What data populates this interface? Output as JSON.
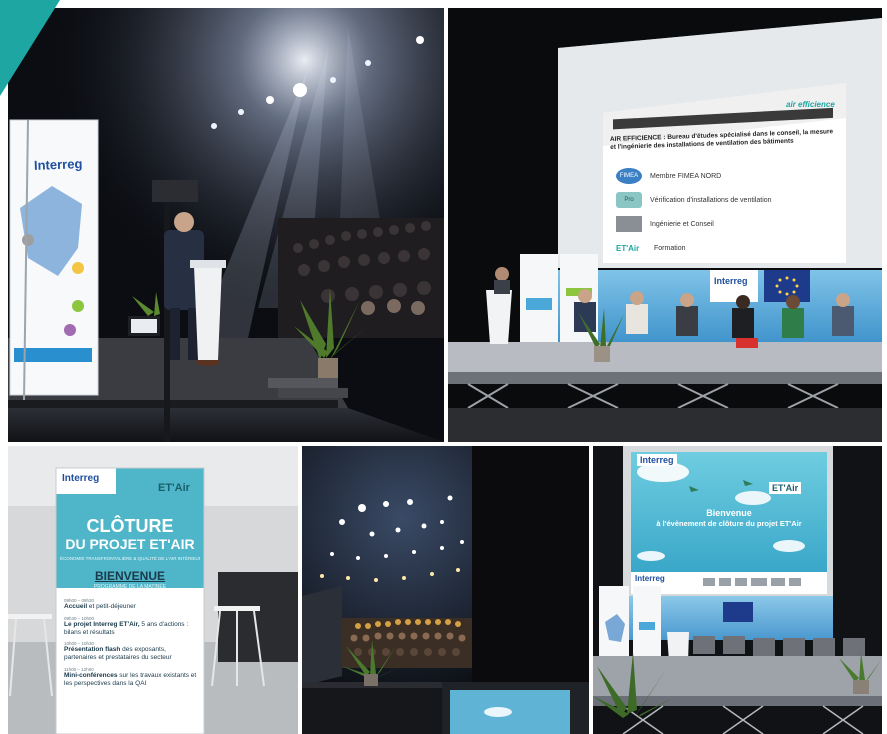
{
  "colors": {
    "teal": "#1ea6a3",
    "banner_teal": "#4fb6c9",
    "stage_blue": "#4aa8d8",
    "dark": "#0a0a0a",
    "eu_blue": "#1e3a8a"
  },
  "photo1": {
    "banner_logo": "Interreg"
  },
  "photo2": {
    "slide_brand": "air efficience",
    "slide_heading": "AIR EFFICIENCE : Bureau d'études spécialisé dans le conseil, la mesure et l'ingénierie des installations de ventilation des bâtiments",
    "items": [
      {
        "icon": "fimea-logo-icon",
        "badge": "FIMEA",
        "label": "Membre FIMEA NORD"
      },
      {
        "icon": "promevent-logo-icon",
        "badge": "Pro",
        "label": "Vérification d'installations de ventilation"
      },
      {
        "icon": "engineering-photo-icon",
        "badge": "",
        "label": "Ingénierie et Conseil"
      },
      {
        "icon": "etair-logo-icon",
        "badge": "ET'Air",
        "label": "Formation"
      }
    ],
    "stage_logo": "Interreg"
  },
  "photo3": {
    "interreg": "Interreg",
    "etair": "ET'Air",
    "title_line1": "CLÔTURE",
    "title_line2": "DU PROJET ET'AIR",
    "subtitle": "ÉCONOMIE TRANSFRONTALIÈRE & QUALITÉ DE L'AIR INTÉRIEUR",
    "bienvenue": "BIENVENUE",
    "programme": "PROGRAMME DE LA MATINÉE",
    "items": [
      {
        "time": "09h00 – 09h30",
        "bold": "Accueil",
        "rest": " et petit-déjeuner"
      },
      {
        "time": "09h30 – 10h00",
        "bold": "Le projet Interreg ET'Air,",
        "rest": " 5 ans d'actions : bilans et résultats"
      },
      {
        "time": "10h00 – 10h30",
        "bold": "Présentation flash",
        "rest": " des exposants, partenaires et prestataires du secteur"
      },
      {
        "time": "11h00 – 12h00",
        "bold": "Mini-conférences",
        "rest": " sur les travaux existants et les perspectives dans la QAI"
      }
    ]
  },
  "photo5": {
    "interreg": "Interreg",
    "etair": "ET'Air",
    "welcome_line1": "Bienvenue",
    "welcome_line2": "à l'évènement de clôture du projet ET'Air"
  }
}
